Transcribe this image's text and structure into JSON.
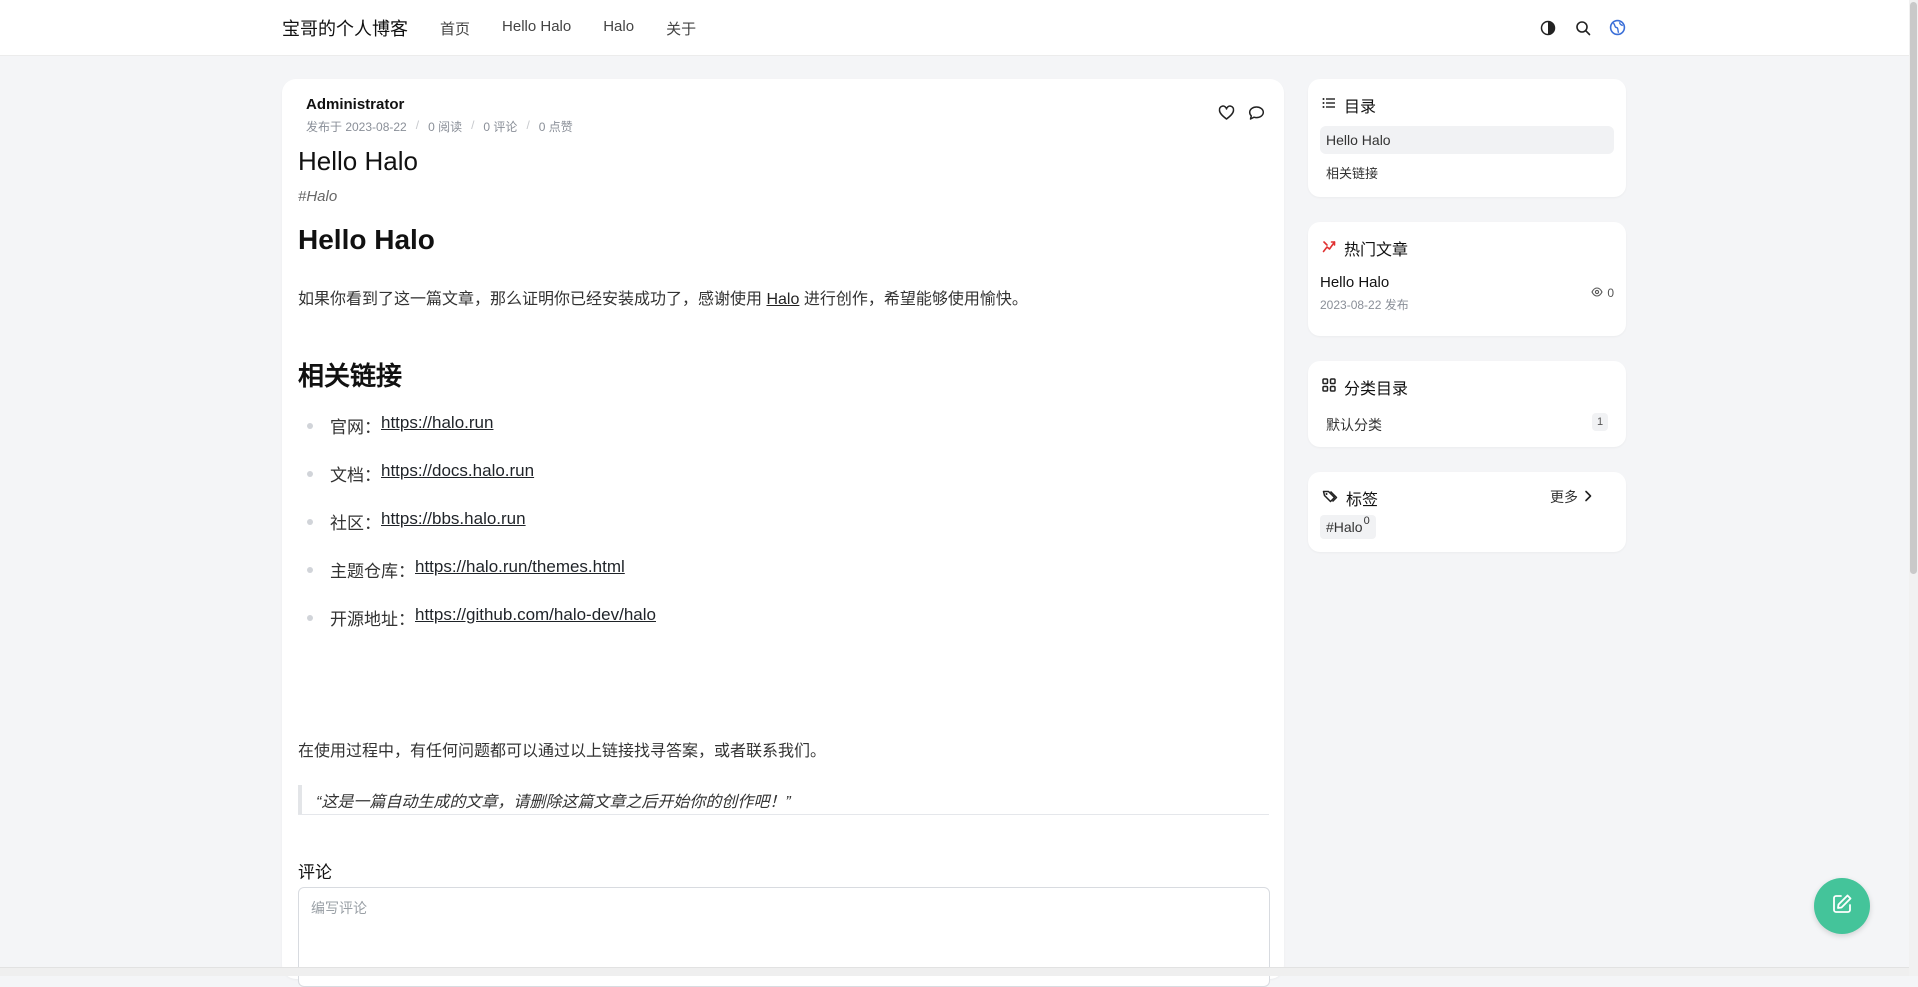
{
  "header": {
    "site_title": "宝哥的个人博客",
    "nav": [
      "首页",
      "Hello Halo",
      "Halo",
      "关于"
    ]
  },
  "post": {
    "author": "Administrator",
    "published": "发布于 2023-08-22",
    "reads": "0 阅读",
    "comments": "0 评论",
    "likes": "0 点赞",
    "title": "Hello Halo",
    "tag": "#Halo",
    "heading": "Hello Halo",
    "intro_before": "如果你看到了这一篇文章，那么证明你已经安装成功了，感谢使用",
    "intro_link": "Halo",
    "intro_after": "进行创作，希望能够使用愉快。",
    "links_heading": "相关链接",
    "links": [
      {
        "label": "官网：",
        "url": "https://halo.run"
      },
      {
        "label": "文档：",
        "url": "https://docs.halo.run"
      },
      {
        "label": "社区：",
        "url": "https://bbs.halo.run"
      },
      {
        "label": "主题仓库：",
        "url": "https://halo.run/themes.html"
      },
      {
        "label": "开源地址：",
        "url": "https://github.com/halo-dev/halo"
      }
    ],
    "closing": "在使用过程中，有任何问题都可以通过以上链接找寻答案，或者联系我们。",
    "quote": "“这是一篇自动生成的文章，请删除这篇文章之后开始你的创作吧！”"
  },
  "comments": {
    "title": "评论",
    "placeholder": "编写评论"
  },
  "sidebar": {
    "toc": {
      "title": "目录",
      "items": [
        "Hello Halo",
        "相关链接"
      ]
    },
    "hot": {
      "title": "热门文章",
      "post_title": "Hello Halo",
      "date": "2023-08-22 发布",
      "views": "0"
    },
    "categories": {
      "title": "分类目录",
      "item": "默认分类",
      "count": "1"
    },
    "tags": {
      "title": "标签",
      "more": "更多",
      "chip": "#Halo",
      "chip_count": "0"
    }
  },
  "colors": {
    "accent": "#44c49a",
    "hot_icon": "#e03131",
    "link": "#1f2328"
  }
}
